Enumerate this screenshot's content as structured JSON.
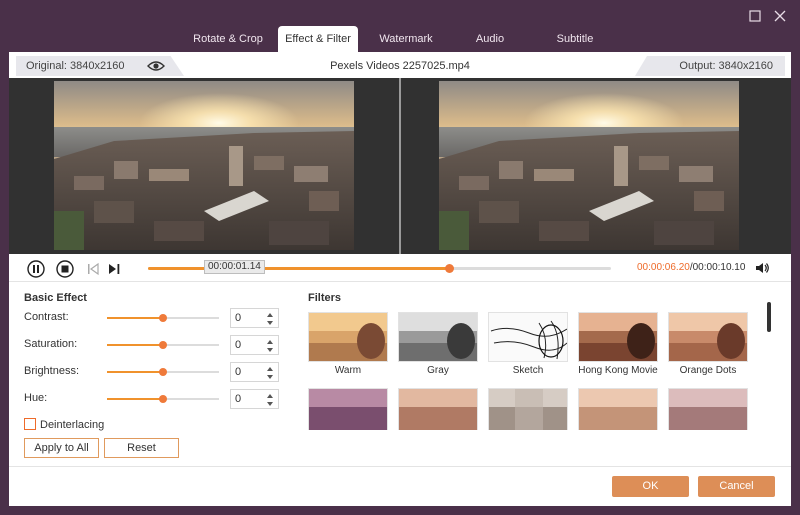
{
  "tabs": [
    {
      "label": "Rotate & Crop",
      "active": false
    },
    {
      "label": "Effect & Filter",
      "active": true
    },
    {
      "label": "Watermark",
      "active": false
    },
    {
      "label": "Audio",
      "active": false
    },
    {
      "label": "Subtitle",
      "active": false
    }
  ],
  "window": {
    "maximize_icon": "maximize-icon",
    "close_icon": "close-icon"
  },
  "info": {
    "original": "Original: 3840x2160",
    "filename": "Pexels Videos 2257025.mp4",
    "output": "Output: 3840x2160"
  },
  "playback": {
    "tooltip": "00:00:01.14",
    "current_time": "00:00:06.20",
    "total_time": "/00:00:10.10",
    "progress": 0.65
  },
  "basic_effect": {
    "title": "Basic Effect",
    "rows": [
      {
        "label": "Contrast:",
        "value": "0",
        "level": 0.5
      },
      {
        "label": "Saturation:",
        "value": "0",
        "level": 0.5
      },
      {
        "label": "Brightness:",
        "value": "0",
        "level": 0.5
      },
      {
        "label": "Hue:",
        "value": "0",
        "level": 0.5
      }
    ],
    "deinterlacing": "Deinterlacing",
    "apply_all": "Apply to All",
    "reset": "Reset"
  },
  "filters": {
    "title": "Filters",
    "items": [
      {
        "label": "Warm"
      },
      {
        "label": "Gray"
      },
      {
        "label": "Sketch"
      },
      {
        "label": "Hong Kong Movie"
      },
      {
        "label": "Orange Dots"
      }
    ]
  },
  "footer": {
    "ok": "OK",
    "cancel": "Cancel"
  },
  "colors": {
    "accent": "#ee6b2a",
    "button": "#dd8e57",
    "titlebar": "#4a3049"
  }
}
